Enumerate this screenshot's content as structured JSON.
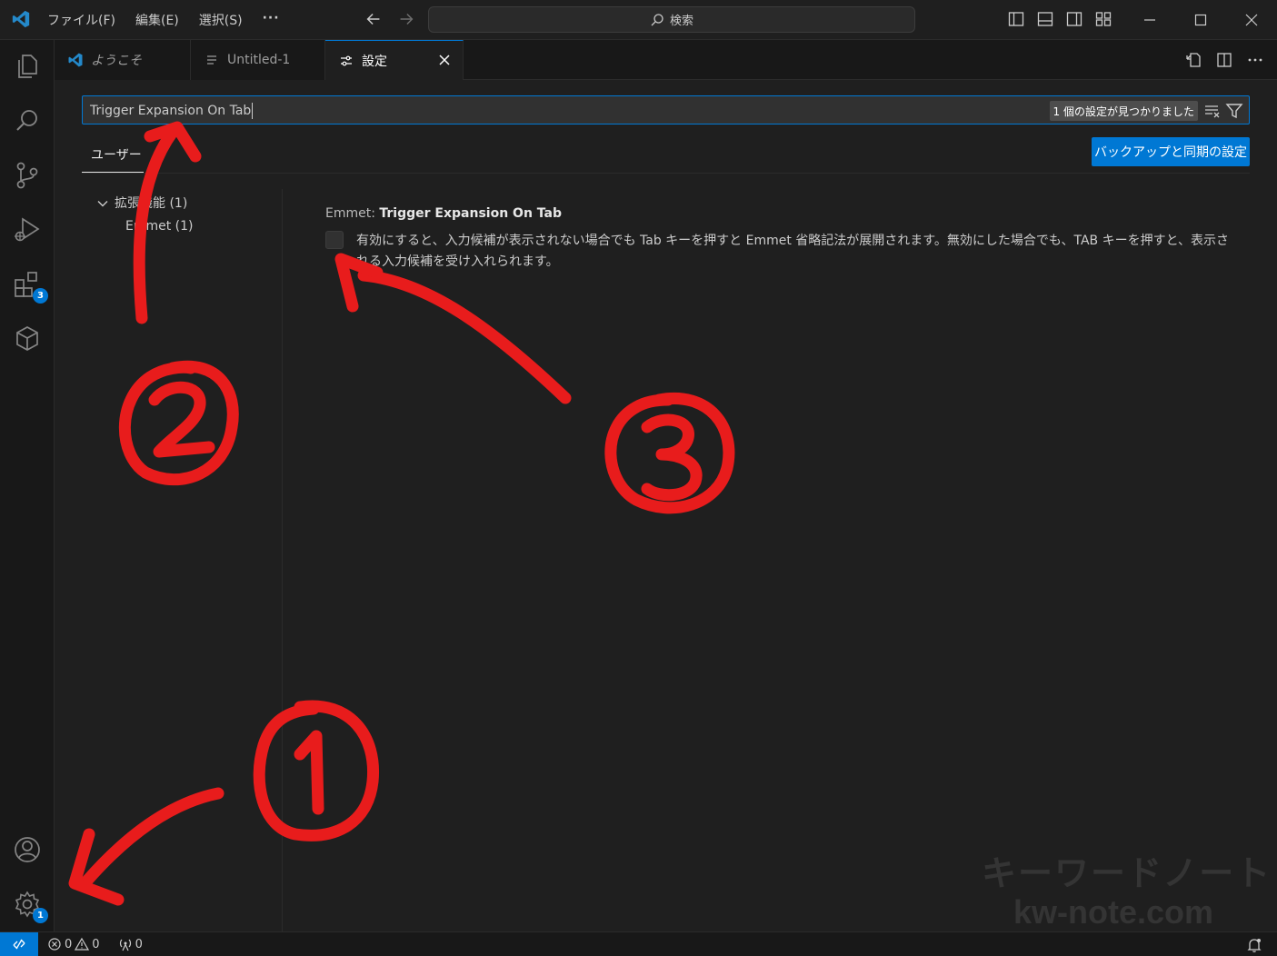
{
  "titlebar": {
    "menu": [
      "ファイル(F)",
      "編集(E)",
      "選択(S)",
      "···"
    ],
    "search_label": "検索"
  },
  "activity_bar": {
    "items": [
      "explorer-icon",
      "search-icon",
      "source-control-icon",
      "run-debug-icon",
      "extensions-icon",
      "remote-explorer-icon"
    ],
    "extensions_badge": "3",
    "manage_badge": "1"
  },
  "tabs": [
    {
      "label": "ようこそ",
      "icon": "vscode-logo-icon"
    },
    {
      "label": "Untitled-1",
      "icon": "file-lines-icon"
    },
    {
      "label": "設定",
      "icon": "settings-sliders-icon",
      "active": true
    }
  ],
  "settings": {
    "search_value": "Trigger Expansion On Tab",
    "result_count": "1 個の設定が見つかりました",
    "scope_tab": "ユーザー",
    "sync_button": "バックアップと同期の設定",
    "toc": [
      {
        "label": "拡張機能 (1)",
        "expanded": true
      },
      {
        "label": "Emmet (1)"
      }
    ],
    "item": {
      "category": "Emmet: ",
      "name": "Trigger Expansion On Tab",
      "checked": false,
      "description": "有効にすると、入力候補が表示されない場合でも Tab キーを押すと Emmet 省略記法が展開されます。無効にした場合でも、TAB キーを押すと、表示される入力候補を受け入れられます。"
    }
  },
  "watermark": {
    "line1": "キーワードノート",
    "line2": "kw-note.com"
  },
  "statusbar": {
    "errors": "0",
    "warnings": "0",
    "ports": "0"
  },
  "colors": {
    "accent": "#0078d4",
    "annotation": "#e81c1c",
    "background": "#1f1f1f"
  }
}
